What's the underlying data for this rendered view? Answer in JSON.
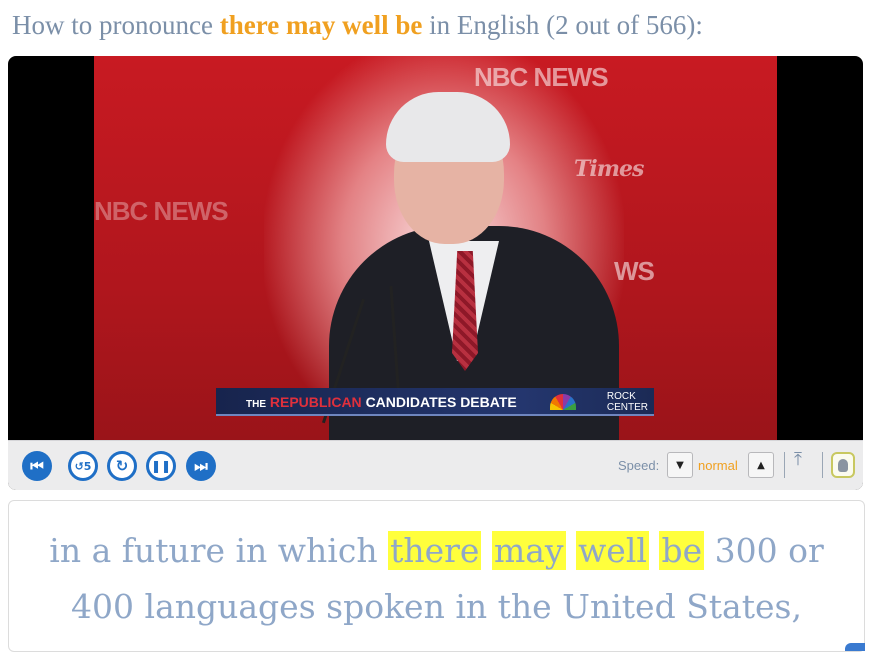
{
  "header": {
    "prefix": "How to pronounce ",
    "phrase": "there may well be",
    "suffix": " in English (2 out of 566):"
  },
  "video": {
    "watermark_top": "NBC NEWS",
    "watermark_left": "NBC NEWS",
    "watermark_right": "WS",
    "watermark_times": "Times",
    "banner_prefix": "THE",
    "banner_highlight": "REPUBLICAN",
    "banner_suffix": "CANDIDATES DEBATE",
    "banner_logo_line1": "ROCK",
    "banner_logo_line2": "CENTER"
  },
  "controls": {
    "prev_icon": "skip-previous-icon",
    "replay5_icon": "replay-5-icon",
    "repeat_icon": "repeat-icon",
    "pause_icon": "pause-icon",
    "next_icon": "skip-next-icon",
    "speed_label": "Speed:",
    "speed_value": "normal",
    "accent": "#1f6fc6"
  },
  "caption": {
    "before": "in a future in which",
    "words": [
      "there",
      "may",
      "well",
      "be"
    ],
    "after_line1": "300 or",
    "line2": "400 languages spoken in the United States,"
  }
}
